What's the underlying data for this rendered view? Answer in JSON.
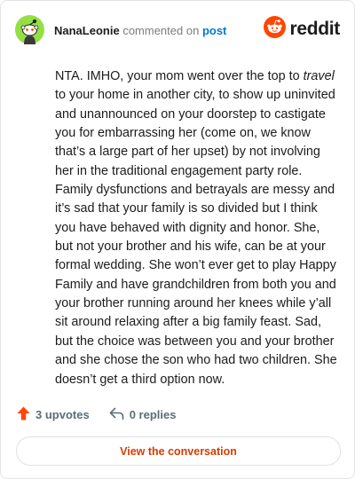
{
  "colors": {
    "accent": "#0079d3",
    "reddit_orange": "#ff4500",
    "cta_text": "#d93a00",
    "avatar_bg": "#94e044",
    "meta_gray": "#7c7c7c",
    "stat_gray": "#576f76"
  },
  "header": {
    "username": "NanaLeonie",
    "action_text": "commented on",
    "post_link": "post",
    "avatar_icon": "snoo-avatar-icon",
    "brand_icon": "reddit-logo-icon",
    "brand_wordmark": "reddit"
  },
  "comment": {
    "body_before_italic": "NTA. IMHO, your mom went over the top to ",
    "body_italic": "travel",
    "body_after_italic": " to your home in another city, to show up uninvited and unannounced on your doorstep to castigate you for embarrassing her (come on, we know that’s a large part of her upset) by not involving her in the traditional engagement party role. Family dysfunctions and betrayals are messy and it’s sad that your family is so divided but I think you have behaved with dignity and honor. She, but not your brother and his wife, can be at your formal wedding. She won’t ever get to play Happy Family and have grandchildren from both you and your brother running around her knees while y’all sit around relaxing after a big family feast. Sad, but the choice was between you and your brother and she chose the son who had two children. She doesn’t get a third option now."
  },
  "footer": {
    "upvotes_icon": "upvote-arrow-icon",
    "upvotes": "3 upvotes",
    "replies_icon": "reply-arrow-icon",
    "replies": "0 replies"
  },
  "cta": {
    "label": "View the conversation"
  }
}
